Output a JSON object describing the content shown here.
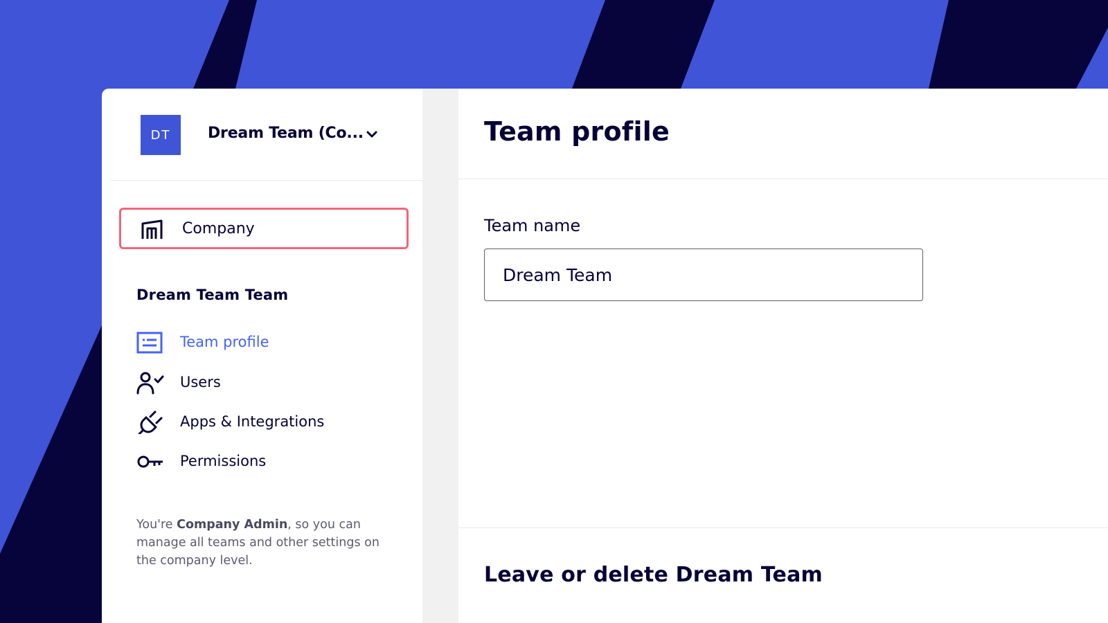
{
  "background": {
    "primary_color": "#4054d8",
    "stripe_color": "#06043a"
  },
  "team_switcher": {
    "avatar_initials": "DT",
    "team_name": "Dream Team (Co...",
    "avatar_color": "#4054d8"
  },
  "company_item": {
    "label": "Company",
    "icon": "company-building-icon",
    "highlight_color": "#f2657a"
  },
  "sidebar": {
    "section_title": "Dream Team Team",
    "items": [
      {
        "label": "Team profile",
        "icon": "team-profile-icon",
        "active": true
      },
      {
        "label": "Users",
        "icon": "user-check-icon",
        "active": false
      },
      {
        "label": "Apps & Integrations",
        "icon": "plug-icon",
        "active": false
      },
      {
        "label": "Permissions",
        "icon": "key-icon",
        "active": false
      }
    ],
    "admin_note": {
      "prefix": "You're ",
      "role": "Company Admin",
      "suffix": ", so you can manage all teams and other settings on the company level."
    },
    "active_color": "#4262ff"
  },
  "main": {
    "title": "Team profile",
    "team_name_label": "Team name",
    "team_name_value": "Dream Team",
    "leave_section_title": "Leave or delete Dream Team"
  }
}
